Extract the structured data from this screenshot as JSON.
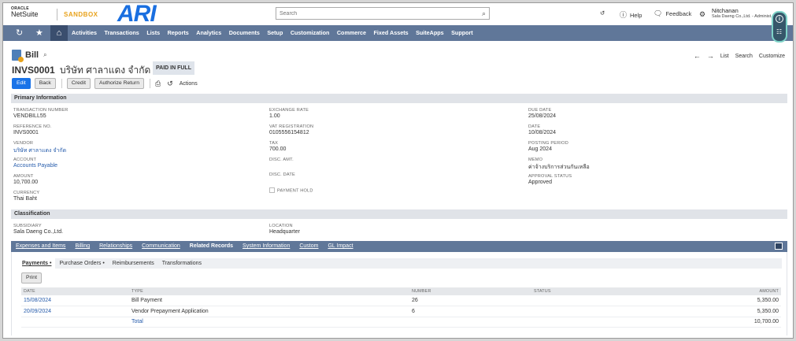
{
  "brand": {
    "oracle": "ORACLE",
    "netsuite": "NetSuite",
    "env": "SANDBOX",
    "company_logo": "ARI"
  },
  "search": {
    "placeholder": "Search"
  },
  "topbar": {
    "help": "Help",
    "feedback": "Feedback"
  },
  "user": {
    "name": "Nitchanan",
    "role": "Sala Daeng Co.,Ltd. - Administ..."
  },
  "nav": [
    "Activities",
    "Transactions",
    "Lists",
    "Reports",
    "Analytics",
    "Documents",
    "Setup",
    "Customization",
    "Commerce",
    "Fixed Assets",
    "SuiteApps",
    "Support"
  ],
  "record": {
    "type": "Bill",
    "number": "INVS0001",
    "vendor_name": "บริษัท ศาลาแดง จำกัด",
    "status": "PAID IN FULL"
  },
  "nav_links": {
    "list": "List",
    "search": "Search",
    "customize": "Customize"
  },
  "buttons": {
    "edit": "Edit",
    "back": "Back",
    "credit": "Credit",
    "authorize_return": "Authorize Return",
    "actions": "Actions"
  },
  "primary": {
    "title": "Primary Information",
    "transaction_number": {
      "label": "TRANSACTION NUMBER",
      "value": "VENDBILL55"
    },
    "reference_no": {
      "label": "REFERENCE NO.",
      "value": "INVS0001"
    },
    "vendor": {
      "label": "VENDOR",
      "value": "บริษัท ศาลาแดง จำกัด"
    },
    "account": {
      "label": "ACCOUNT",
      "value": "Accounts Payable"
    },
    "amount": {
      "label": "AMOUNT",
      "value": "10,700.00"
    },
    "currency": {
      "label": "CURRENCY",
      "value": "Thai Baht"
    },
    "exchange_rate": {
      "label": "EXCHANGE RATE",
      "value": "1.00"
    },
    "vat_registration": {
      "label": "VAT REGISTRATION",
      "value": "0105556154812"
    },
    "tax": {
      "label": "TAX",
      "value": "700.00"
    },
    "disc_amt": {
      "label": "DISC. AMT."
    },
    "disc_date": {
      "label": "DISC. DATE"
    },
    "payment_hold": {
      "label": "PAYMENT HOLD"
    },
    "due_date": {
      "label": "DUE DATE",
      "value": "25/08/2024"
    },
    "date": {
      "label": "DATE",
      "value": "10/08/2024"
    },
    "posting_period": {
      "label": "POSTING PERIOD",
      "value": "Aug 2024"
    },
    "memo": {
      "label": "MEMO",
      "value": "ค่าจ้างบริการส่วนกันเหลือ"
    },
    "approval_status": {
      "label": "APPROVAL STATUS",
      "value": "Approved"
    }
  },
  "classification": {
    "title": "Classification",
    "subsidiary": {
      "label": "SUBSIDIARY",
      "value": "Sala Daeng Co.,Ltd."
    },
    "location": {
      "label": "LOCATION",
      "value": "Headquarter"
    }
  },
  "subtabs": [
    "Expenses and Items",
    "Billing",
    "Relationships",
    "Communication",
    "Related Records",
    "System Information",
    "Custom",
    "GL Impact"
  ],
  "active_subtab": "Related Records",
  "inner_tabs": [
    "Payments •",
    "Purchase Orders •",
    "Reimbursements",
    "Transformations"
  ],
  "print_label": "Print",
  "related_table": {
    "headers": {
      "date": "DATE",
      "type": "TYPE",
      "number": "NUMBER",
      "status": "STATUS",
      "amount": "AMOUNT"
    },
    "rows": [
      {
        "date": "15/08/2024",
        "type": "Bill Payment",
        "number": "26",
        "status": "",
        "amount": "5,350.00"
      },
      {
        "date": "20/09/2024",
        "type": "Vendor Prepayment Application",
        "number": "6",
        "status": "",
        "amount": "5,350.00"
      }
    ],
    "total_label": "Total",
    "total_amount": "10,700.00"
  }
}
